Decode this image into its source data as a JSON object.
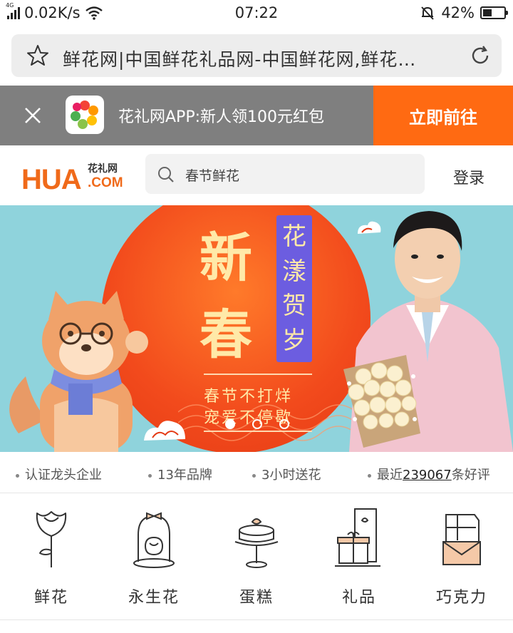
{
  "status_bar": {
    "network": "4G",
    "speed": "0.02K/s",
    "time": "07:22",
    "battery": "42%",
    "battery_level": 0.42
  },
  "url_bar": {
    "title": "鲜花网|中国鲜花礼品网-中国鲜花网,鲜花…"
  },
  "app_banner": {
    "text": "花礼网APP:新人领100元红包",
    "cta": "立即前往"
  },
  "header": {
    "logo_main": "HUA",
    "logo_cn": "花礼网",
    "logo_com": ".COM",
    "search_placeholder": "春节鲜花",
    "login": "登录"
  },
  "hero": {
    "headline_1": "新",
    "headline_2": "春",
    "banner_chars": [
      "花",
      "漾",
      "贺",
      "岁"
    ],
    "slogan_1": "春节不打烊",
    "slogan_2": "宠爱不停歇",
    "slide_count": 3,
    "active_slide": 1
  },
  "trust": {
    "items": [
      "认证龙头企业",
      "13年品牌",
      "3小时送花"
    ],
    "review_prefix": "最近",
    "review_count": "239067",
    "review_suffix": "条好评"
  },
  "categories": [
    {
      "label": "鲜花",
      "icon": "rose-icon"
    },
    {
      "label": "永生花",
      "icon": "preserved-flower-icon"
    },
    {
      "label": "蛋糕",
      "icon": "cake-icon"
    },
    {
      "label": "礼品",
      "icon": "gift-icon"
    },
    {
      "label": "巧克力",
      "icon": "chocolate-icon"
    }
  ],
  "colors": {
    "brand_orange": "#ff6a12",
    "banner_gray": "#7f7f7f",
    "hero_bg": "#8fd3dc"
  }
}
